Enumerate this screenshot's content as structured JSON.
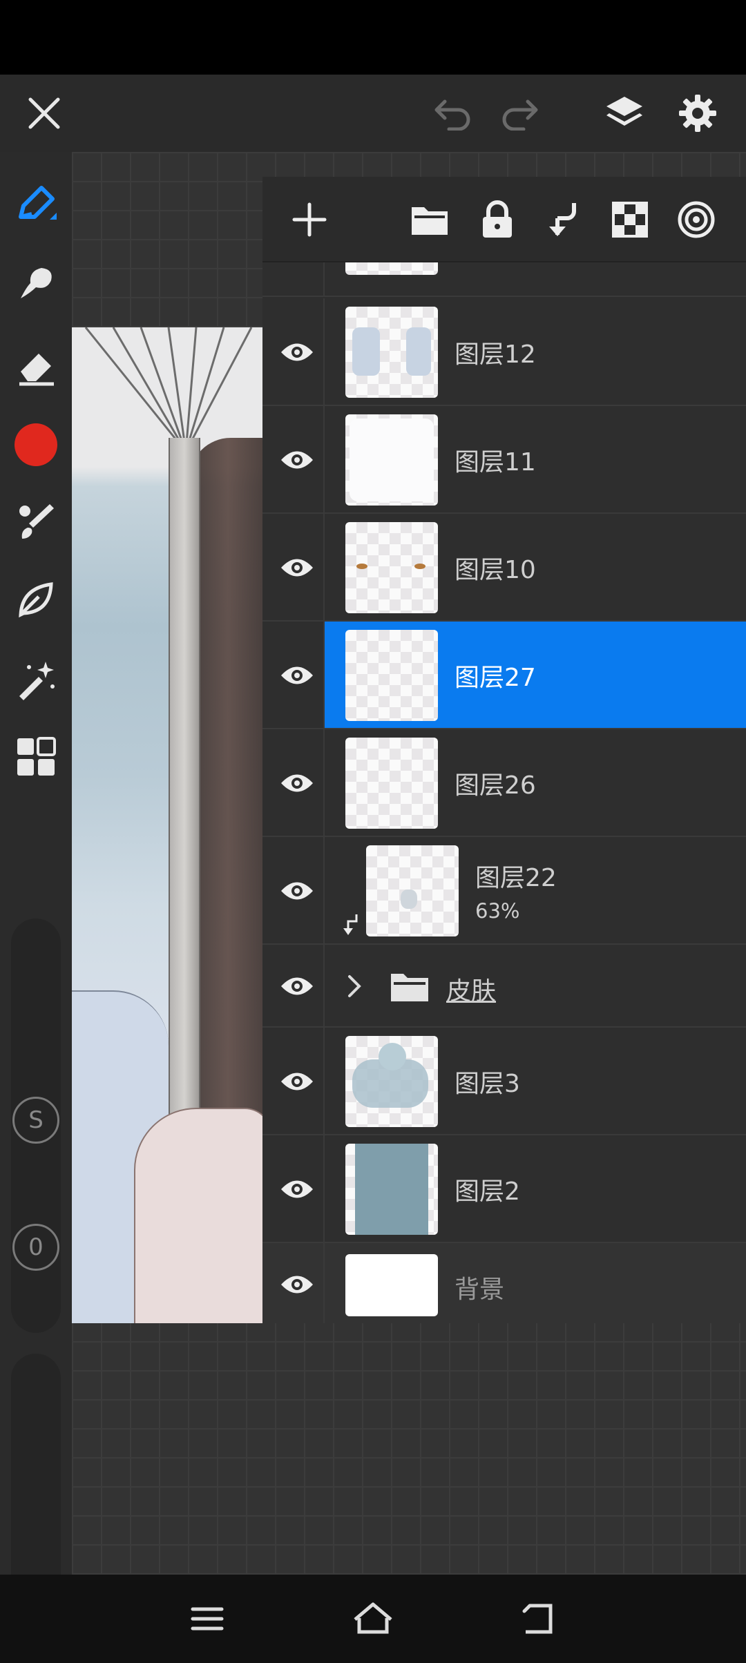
{
  "colors": {
    "accent": "#0a7bef",
    "current_color": "#e0281e",
    "panel": "#2e2e2e"
  },
  "top_bar": {
    "close_icon": "close-icon",
    "undo_icon": "undo-icon",
    "redo_icon": "redo-icon",
    "layers_icon": "layers-icon",
    "settings_icon": "gear-icon"
  },
  "tools": [
    {
      "name": "pen-tool-icon",
      "active": true
    },
    {
      "name": "smudge-tool-icon"
    },
    {
      "name": "eraser-tool-icon"
    },
    {
      "name": "color-swatch"
    },
    {
      "name": "brush-tool-icon"
    },
    {
      "name": "leaf-tool-icon"
    },
    {
      "name": "magic-wand-icon"
    },
    {
      "name": "grid-menu-icon"
    }
  ],
  "sliders": {
    "size_label": "S",
    "opacity_label": "0"
  },
  "layers_panel": {
    "toolbar": [
      "add-layer-icon",
      "folder-icon",
      "lock-icon",
      "clip-mask-icon",
      "transparency-icon",
      "blend-mode-icon"
    ],
    "layers": [
      {
        "name": "图层12",
        "visible": true
      },
      {
        "name": "图层11",
        "visible": true
      },
      {
        "name": "图层10",
        "visible": true
      },
      {
        "name": "图层27",
        "visible": true,
        "selected": true
      },
      {
        "name": "图层26",
        "visible": true
      },
      {
        "name": "图层22",
        "opacity": "63%",
        "clipped": true,
        "visible": true
      },
      {
        "name": "皮肤",
        "is_group": true,
        "visible": true
      },
      {
        "name": "图层3",
        "visible": true
      },
      {
        "name": "图层2",
        "visible": true
      },
      {
        "name": "背景",
        "visible": true,
        "background": true
      }
    ]
  },
  "nav": [
    "menu-icon",
    "home-icon",
    "back-icon"
  ]
}
